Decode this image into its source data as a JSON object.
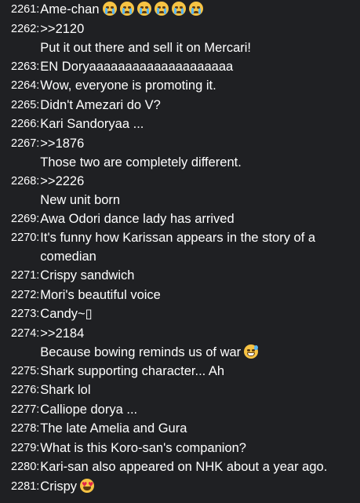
{
  "comments": [
    {
      "number": "2261:",
      "lines": [
        "Ame-chan"
      ],
      "emoji": "crying-face",
      "emoji_count": 6
    },
    {
      "number": "2262:",
      "lines": [
        ">>2120",
        "Put it out there and sell it on Mercari!"
      ]
    },
    {
      "number": "2263:",
      "lines": [
        "EN Doryaaaaaaaaaaaaaaaaaaaa"
      ]
    },
    {
      "number": "2264:",
      "lines": [
        "Wow, everyone is promoting it."
      ]
    },
    {
      "number": "2265:",
      "lines": [
        "Didn't Amezari do V?"
      ]
    },
    {
      "number": "2266:",
      "lines": [
        "Kari Sandoryaa ..."
      ]
    },
    {
      "number": "2267:",
      "lines": [
        ">>1876",
        "Those two are completely different."
      ]
    },
    {
      "number": "2268:",
      "lines": [
        ">>2226",
        "New unit born"
      ]
    },
    {
      "number": "2269:",
      "lines": [
        "Awa Odori dance lady has arrived"
      ]
    },
    {
      "number": "2270:",
      "lines": [
        "It's funny how Karissan appears in the story of a comedian"
      ],
      "wrap": true
    },
    {
      "number": "2271:",
      "lines": [
        "Crispy sandwich"
      ]
    },
    {
      "number": "2272:",
      "lines": [
        "Mori's beautiful voice"
      ]
    },
    {
      "number": "2273:",
      "lines": [
        "Candy~▯"
      ]
    },
    {
      "number": "2274:",
      "lines": [
        ">>2184",
        "Because bowing reminds us of war"
      ],
      "emoji": "sweat-smile-face",
      "emoji_count": 1
    },
    {
      "number": "2275:",
      "lines": [
        "Shark supporting character... Ah"
      ]
    },
    {
      "number": "2276:",
      "lines": [
        "Shark lol"
      ]
    },
    {
      "number": "2277:",
      "lines": [
        "Calliope dorya ..."
      ]
    },
    {
      "number": "2278:",
      "lines": [
        "The late Amelia and Gura"
      ]
    },
    {
      "number": "2279:",
      "lines": [
        "What is this Koro-san's companion?"
      ]
    },
    {
      "number": "2280:",
      "lines": [
        "Kari-san also appeared on NHK about a year ago."
      ]
    },
    {
      "number": "2281:",
      "lines": [
        "Crispy"
      ],
      "emoji": "heart-eyes-face",
      "emoji_count": 1
    }
  ],
  "colors": {
    "background": "#1f2023",
    "text": "#ffffff"
  }
}
